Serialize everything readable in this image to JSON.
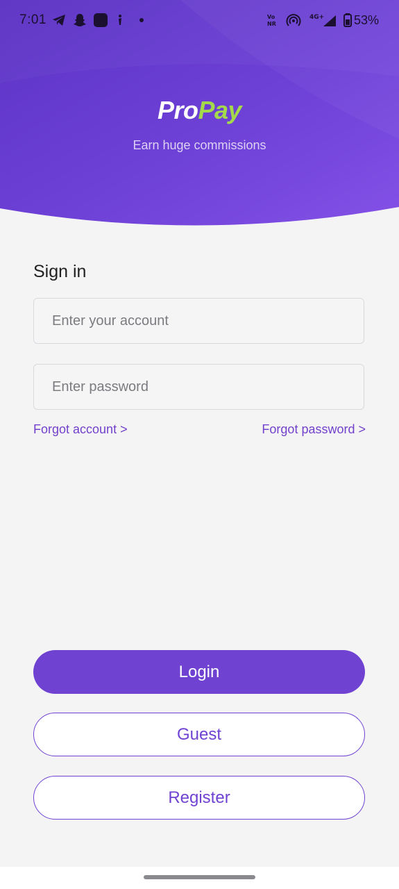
{
  "status_bar": {
    "time": "7:01",
    "battery": "53%",
    "network": "4G+",
    "volte": "Vo",
    "nr": "NR",
    "icons": [
      "telegram-icon",
      "snapchat-icon",
      "app-icon",
      "notification-icon",
      "dot-icon",
      "volte-icon",
      "hotspot-icon",
      "signal-icon",
      "battery-icon"
    ]
  },
  "header": {
    "brand_part1": "Pro",
    "brand_part2": "Pay",
    "tagline": "Earn huge commissions"
  },
  "form": {
    "title": "Sign in",
    "account_placeholder": "Enter your account",
    "account_value": "",
    "password_placeholder": "Enter password",
    "password_value": "",
    "forgot_account": "Forgot account >",
    "forgot_password": "Forgot password >"
  },
  "actions": {
    "login": "Login",
    "guest": "Guest",
    "register": "Register"
  },
  "colors": {
    "primary": "#6f42d2",
    "brand_accent": "#a3d94a",
    "background": "#f4f4f5"
  }
}
